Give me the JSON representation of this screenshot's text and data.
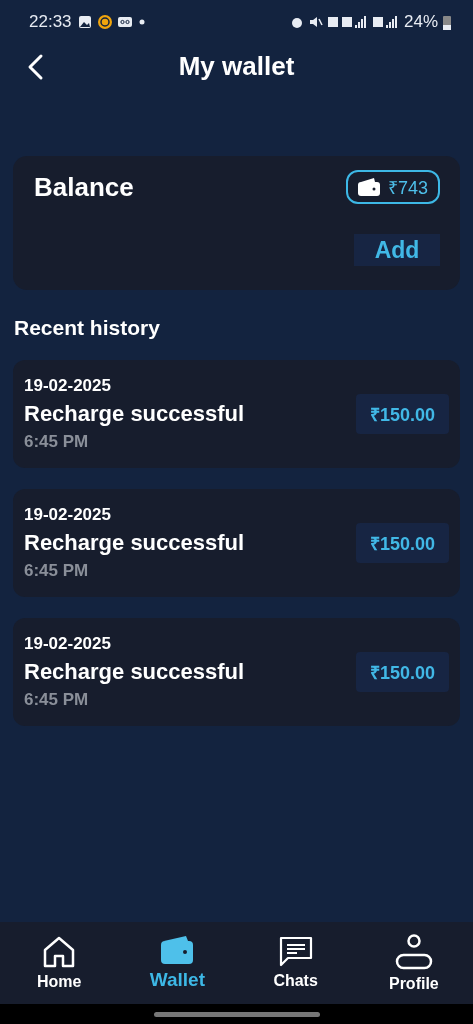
{
  "status_bar": {
    "time": "22:33",
    "battery": "24%"
  },
  "header": {
    "title": "My wallet"
  },
  "balance": {
    "label": "Balance",
    "amount": "₹743",
    "button": "Add"
  },
  "history": {
    "title": "Recent history",
    "items": [
      {
        "date": "19-02-2025",
        "title": "Recharge successful",
        "time": "6:45 PM",
        "amount": "₹150.00"
      },
      {
        "date": "19-02-2025",
        "title": "Recharge successful",
        "time": "6:45 PM",
        "amount": "₹150.00"
      },
      {
        "date": "19-02-2025",
        "title": "Recharge successful",
        "time": "6:45 PM",
        "amount": "₹150.00"
      }
    ]
  },
  "nav": [
    {
      "kind": "home",
      "label": "Home",
      "selected": false
    },
    {
      "kind": "wallet",
      "label": "Wallet",
      "selected": true
    },
    {
      "kind": "chats",
      "label": "Chats",
      "selected": false
    },
    {
      "kind": "profile",
      "label": "Profile",
      "selected": false
    }
  ]
}
